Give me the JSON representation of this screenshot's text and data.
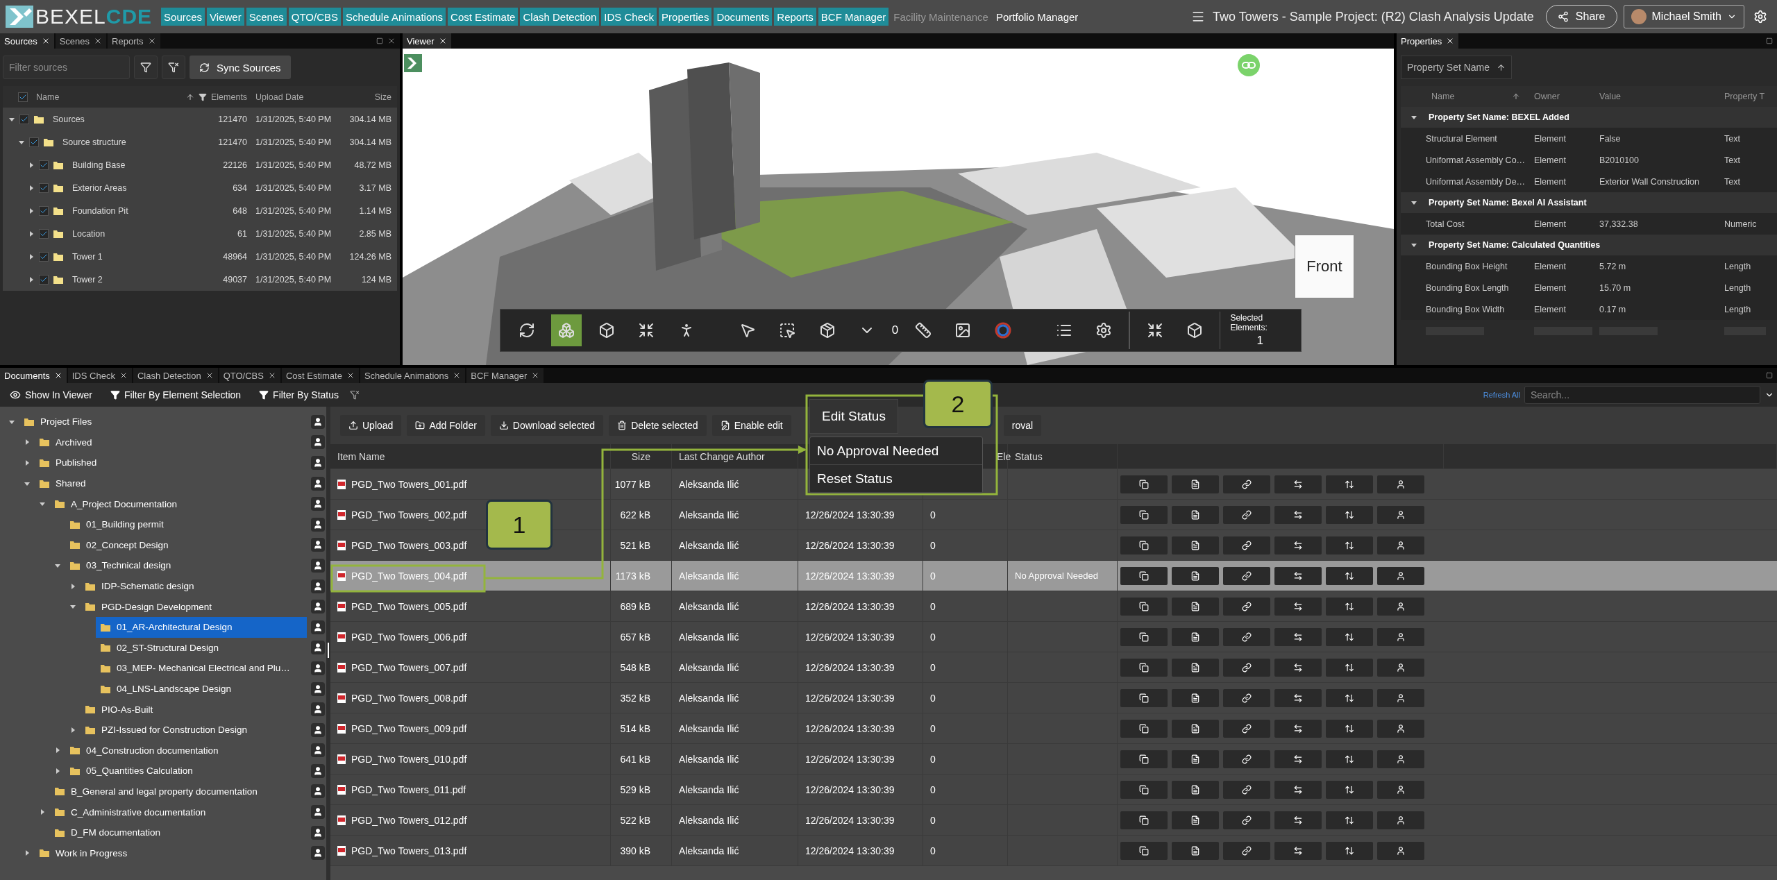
{
  "logo": {
    "text": "BEXEL",
    "accent": "CDE"
  },
  "nav": [
    {
      "label": "Sources",
      "kind": "module"
    },
    {
      "label": "Viewer",
      "kind": "module"
    },
    {
      "label": "Scenes",
      "kind": "module"
    },
    {
      "label": "QTO/CBS",
      "kind": "module"
    },
    {
      "label": "Schedule Animations",
      "kind": "module"
    },
    {
      "label": "Cost Estimate",
      "kind": "module"
    },
    {
      "label": "Clash Detection",
      "kind": "module"
    },
    {
      "label": "IDS Check",
      "kind": "module"
    },
    {
      "label": "Properties",
      "kind": "module"
    },
    {
      "label": "Documents",
      "kind": "module"
    },
    {
      "label": "Reports",
      "kind": "module"
    },
    {
      "label": "BCF Manager",
      "kind": "module"
    },
    {
      "label": "Facility Maintenance",
      "kind": "disabled"
    },
    {
      "label": "Portfolio Manager",
      "kind": "link"
    }
  ],
  "project_title": "Two Towers - Sample Project: (R2) Clash Analysis Update",
  "share_button": "Share",
  "user": {
    "name": "Michael Smith"
  },
  "sources_panel": {
    "tabs": [
      {
        "label": "Sources",
        "selected": true
      },
      {
        "label": "Scenes",
        "selected": false
      },
      {
        "label": "Reports",
        "selected": false
      }
    ],
    "filter_placeholder": "Filter sources",
    "sync_button": "Sync Sources",
    "columns": [
      "Name",
      "Elements",
      "Upload Date",
      "Size"
    ],
    "all_checked": true,
    "rows": [
      {
        "name": "Sources",
        "elements": "121470",
        "date": "1/31/2025, 5:40 PM",
        "size": "304.14 MB",
        "checked": true,
        "expanded": true,
        "children": [
          {
            "name": "Source structure",
            "elements": "121470",
            "date": "1/31/2025, 5:40 PM",
            "size": "304.14 MB",
            "checked": true,
            "expanded": true,
            "children": [
              {
                "name": "Building Base",
                "elements": "22126",
                "date": "1/31/2025, 5:40 PM",
                "size": "48.72 MB",
                "checked": true,
                "expanded": false
              },
              {
                "name": "Exterior Areas",
                "elements": "634",
                "date": "1/31/2025, 5:40 PM",
                "size": "3.17 MB",
                "checked": true,
                "expanded": false
              },
              {
                "name": "Foundation Pit",
                "elements": "648",
                "date": "1/31/2025, 5:40 PM",
                "size": "1.14 MB",
                "checked": true,
                "expanded": false
              },
              {
                "name": "Location",
                "elements": "61",
                "date": "1/31/2025, 5:40 PM",
                "size": "2.85 MB",
                "checked": true,
                "expanded": false
              },
              {
                "name": "Tower 1",
                "elements": "48964",
                "date": "1/31/2025, 5:40 PM",
                "size": "124.26 MB",
                "checked": true,
                "expanded": false
              },
              {
                "name": "Tower 2",
                "elements": "49037",
                "date": "1/31/2025, 5:40 PM",
                "size": "124 MB",
                "checked": true,
                "expanded": false
              }
            ]
          }
        ]
      }
    ]
  },
  "viewer": {
    "tab": "Viewer",
    "cube_label": "Front",
    "selected_label": "Selected Elements:",
    "selected_count": "1",
    "tools": [
      {
        "kind": "orbit",
        "selected": false
      },
      {
        "kind": "section",
        "selected": true
      },
      {
        "kind": "cube",
        "selected": false
      },
      {
        "kind": "fit",
        "selected": false
      },
      {
        "kind": "walk",
        "selected": false
      },
      {
        "kind": "gap"
      },
      {
        "kind": "pointer",
        "selected": false
      },
      {
        "kind": "box-select",
        "selected": false
      },
      {
        "kind": "solid",
        "selected": false
      },
      {
        "kind": "caret",
        "selected": false
      },
      {
        "kind": "counter",
        "text": "0"
      },
      {
        "kind": "measure",
        "selected": false
      },
      {
        "kind": "image",
        "selected": false
      },
      {
        "kind": "ring",
        "selected": false
      },
      {
        "kind": "gap"
      },
      {
        "kind": "list",
        "selected": false
      },
      {
        "kind": "settings",
        "selected": false
      },
      {
        "kind": "divider"
      },
      {
        "kind": "fit",
        "selected": false
      },
      {
        "kind": "box-off",
        "selected": false
      },
      {
        "kind": "divider"
      }
    ]
  },
  "properties_panel": {
    "tab": "Properties",
    "sort_button": "Property Set Name",
    "columns": [
      "Name",
      "Owner",
      "Value",
      "Property T"
    ],
    "groups": [
      {
        "title": "Property Set Name: BEXEL Added",
        "expanded": true,
        "rows": [
          [
            "Structural Element",
            "Element",
            "False",
            "Text"
          ],
          [
            "Uniformat Assembly Co…",
            "Element",
            "B2010100",
            "Text"
          ],
          [
            "Uniformat Assembly De…",
            "Element",
            "Exterior Wall Construction",
            "Text"
          ]
        ]
      },
      {
        "title": "Property Set Name: Bexel AI Assistant",
        "expanded": true,
        "rows": [
          [
            "Total Cost",
            "Element",
            "37,332.38",
            "Numeric"
          ]
        ]
      },
      {
        "title": "Property Set Name: Calculated Quantities",
        "expanded": true,
        "rows": [
          [
            "Bounding Box Height",
            "Element",
            "5.72 m",
            "Length"
          ],
          [
            "Bounding Box Length",
            "Element",
            "15.70 m",
            "Length"
          ],
          [
            "Bounding Box Width",
            "Element",
            "0.17 m",
            "Length"
          ]
        ]
      }
    ]
  },
  "documents": {
    "tabs": [
      {
        "label": "Documents",
        "selected": true
      },
      {
        "label": "IDS Check",
        "selected": false
      },
      {
        "label": "Clash Detection",
        "selected": false
      },
      {
        "label": "QTO/CBS",
        "selected": false
      },
      {
        "label": "Cost Estimate",
        "selected": false
      },
      {
        "label": "Schedule Animations",
        "selected": false
      },
      {
        "label": "BCF Manager",
        "selected": false
      }
    ],
    "toolbar": [
      {
        "label": "Show In Viewer",
        "kind": "view"
      },
      {
        "label": "Filter By Element Selection",
        "kind": "filter"
      },
      {
        "label": "Filter By Status",
        "kind": "filter"
      }
    ],
    "refresh_link": "Refresh All",
    "search_placeholder": "Search...",
    "tree": [
      {
        "name": "Project Files",
        "expanded": true,
        "selected": false,
        "children": [
          {
            "name": "Archived",
            "expanded": false,
            "selected": false
          },
          {
            "name": "Published",
            "expanded": false,
            "selected": false
          },
          {
            "name": "Shared",
            "expanded": true,
            "selected": false,
            "children": [
              {
                "name": "A_Project Documentation",
                "expanded": true,
                "selected": false,
                "children": [
                  {
                    "name": "01_Building permit",
                    "selected": false
                  },
                  {
                    "name": "02_Concept Design",
                    "selected": false
                  },
                  {
                    "name": "03_Technical design",
                    "expanded": true,
                    "selected": false,
                    "children": [
                      {
                        "name": "IDP-Schematic design",
                        "expanded": false,
                        "selected": false
                      },
                      {
                        "name": "PGD-Design Development",
                        "expanded": true,
                        "selected": false,
                        "children": [
                          {
                            "name": "01_AR-Architectural Design",
                            "selected": true
                          },
                          {
                            "name": "02_ST-Structural Design",
                            "selected": false
                          },
                          {
                            "name": "03_MEP- Mechanical Electrical and Plu…",
                            "selected": false
                          },
                          {
                            "name": "04_LNS-Landscape Design",
                            "selected": false
                          }
                        ]
                      },
                      {
                        "name": "PIO-As-Built",
                        "selected": false
                      },
                      {
                        "name": "PZI-Issued for Construction Design",
                        "expanded": false,
                        "selected": false
                      }
                    ]
                  },
                  {
                    "name": "04_Construction documentation",
                    "expanded": false,
                    "selected": false
                  },
                  {
                    "name": "05_Quantities Calculation",
                    "expanded": false,
                    "selected": false
                  }
                ]
              },
              {
                "name": "B_General and legal property documentation",
                "selected": false
              },
              {
                "name": "C_Administrative documentation",
                "expanded": false,
                "selected": false
              },
              {
                "name": "D_FM documentation",
                "selected": false
              }
            ]
          },
          {
            "name": "Work in Progress",
            "expanded": false,
            "selected": false
          }
        ]
      }
    ],
    "actions": [
      {
        "label": "Upload",
        "kind": "upload"
      },
      {
        "label": "Add Folder",
        "kind": "folder"
      },
      {
        "label": "Download selected",
        "kind": "download"
      },
      {
        "label": "Delete selected",
        "kind": "delete"
      },
      {
        "label": "Enable edit",
        "kind": "edit"
      }
    ],
    "hidden_action": "roval",
    "columns": {
      "name": "Item Name",
      "size": "Size",
      "author": "Last Change Author",
      "count_partial": "Ele",
      "status": "Status"
    },
    "rows": [
      {
        "name": "PGD_Two Towers_001.pdf",
        "size": "1077 kB",
        "author": "Aleksanda Ilić",
        "selected": false
      },
      {
        "name": "PGD_Two Towers_002.pdf",
        "size": "622 kB",
        "author": "Aleksanda Ilić",
        "date": "12/26/2024 13:30:39",
        "count": "0",
        "selected": false
      },
      {
        "name": "PGD_Two Towers_003.pdf",
        "size": "521 kB",
        "author": "Aleksanda Ilić",
        "date": "12/26/2024 13:30:39",
        "count": "0",
        "selected": false
      },
      {
        "name": "PGD_Two Towers_004.pdf",
        "size": "1173 kB",
        "author": "Aleksanda Ilić",
        "date": "12/26/2024 13:30:39",
        "count": "0",
        "status": "No Approval Needed",
        "selected": true
      },
      {
        "name": "PGD_Two Towers_005.pdf",
        "size": "689 kB",
        "author": "Aleksanda Ilić",
        "date": "12/26/2024 13:30:39",
        "count": "0",
        "selected": false
      },
      {
        "name": "PGD_Two Towers_006.pdf",
        "size": "657 kB",
        "author": "Aleksanda Ilić",
        "date": "12/26/2024 13:30:39",
        "count": "0",
        "selected": false
      },
      {
        "name": "PGD_Two Towers_007.pdf",
        "size": "548 kB",
        "author": "Aleksanda Ilić",
        "date": "12/26/2024 13:30:39",
        "count": "0",
        "selected": false
      },
      {
        "name": "PGD_Two Towers_008.pdf",
        "size": "352 kB",
        "author": "Aleksanda Ilić",
        "date": "12/26/2024 13:30:39",
        "count": "0",
        "selected": false
      },
      {
        "name": "PGD_Two Towers_009.pdf",
        "size": "514 kB",
        "author": "Aleksanda Ilić",
        "date": "12/26/2024 13:30:39",
        "count": "0",
        "selected": false
      },
      {
        "name": "PGD_Two Towers_010.pdf",
        "size": "641 kB",
        "author": "Aleksanda Ilić",
        "date": "12/26/2024 13:30:39",
        "count": "0",
        "selected": false
      },
      {
        "name": "PGD_Two Towers_011.pdf",
        "size": "529 kB",
        "author": "Aleksanda Ilić",
        "date": "12/26/2024 13:30:39",
        "count": "0",
        "selected": false
      },
      {
        "name": "PGD_Two Towers_012.pdf",
        "size": "522 kB",
        "author": "Aleksanda Ilić",
        "date": "12/26/2024 13:30:39",
        "count": "0",
        "selected": false
      },
      {
        "name": "PGD_Two Towers_013.pdf",
        "size": "390 kB",
        "author": "Aleksanda Ilić",
        "date": "12/26/2024 13:30:39",
        "count": "0",
        "selected": false
      }
    ],
    "status_menu": {
      "button": "Edit Status",
      "items": [
        "No Approval Needed",
        "Reset Status"
      ]
    },
    "callouts": [
      "1",
      "2"
    ]
  }
}
